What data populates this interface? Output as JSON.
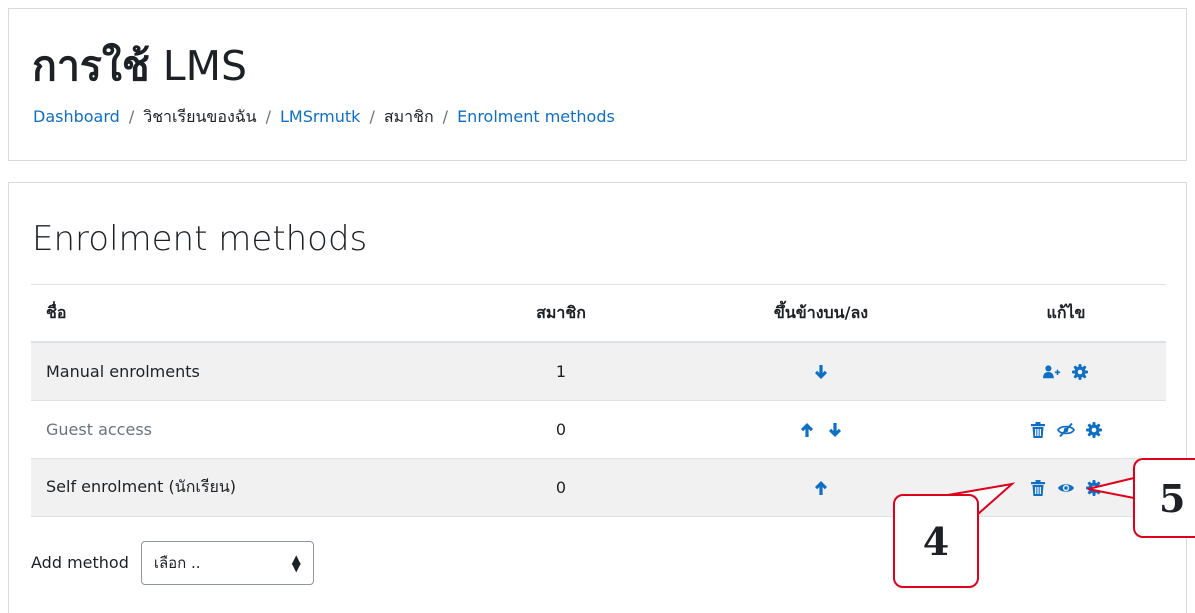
{
  "header": {
    "course_title_prefix": "การใช้",
    "course_title_suffix": "LMS",
    "breadcrumb": [
      {
        "label": "Dashboard",
        "link": true
      },
      {
        "label": "วิชาเรียนของฉัน",
        "link": false
      },
      {
        "label": "LMSrmutk",
        "link": true
      },
      {
        "label": "สมาชิก",
        "link": false
      },
      {
        "label": "Enrolment methods",
        "link": true
      }
    ]
  },
  "page_heading": "Enrolment methods",
  "table": {
    "columns": [
      "ชื่อ",
      "สมาชิก",
      "ขึ้นข้างบน/ลง",
      "แก้ไข"
    ],
    "rows": [
      {
        "name": "Manual enrolments",
        "count": "1",
        "muted": false,
        "updown": [
          "arrow-down-icon"
        ],
        "edit": [
          "enrol-users-icon",
          "settings-gear-icon"
        ]
      },
      {
        "name": "Guest access",
        "count": "0",
        "muted": true,
        "updown": [
          "arrow-up-icon",
          "arrow-down-icon"
        ],
        "edit": [
          "delete-trash-icon",
          "hidden-eye-slash-icon",
          "settings-gear-icon"
        ]
      },
      {
        "name": "Self enrolment (นักเรียน)",
        "count": "0",
        "muted": false,
        "updown": [
          "arrow-up-icon"
        ],
        "edit": [
          "delete-trash-icon",
          "visible-eye-icon",
          "settings-gear-icon"
        ]
      }
    ]
  },
  "add_method": {
    "label": "Add method",
    "selected": "เลือก .."
  },
  "callouts": [
    {
      "label": "4",
      "points_to": "delete-trash-icon"
    },
    {
      "label": "5",
      "points_to": "settings-gear-icon"
    }
  ],
  "colors": {
    "accent": "#0f6fc5",
    "callout_border": "#e0001b",
    "stripe": "#f1f1f1"
  }
}
